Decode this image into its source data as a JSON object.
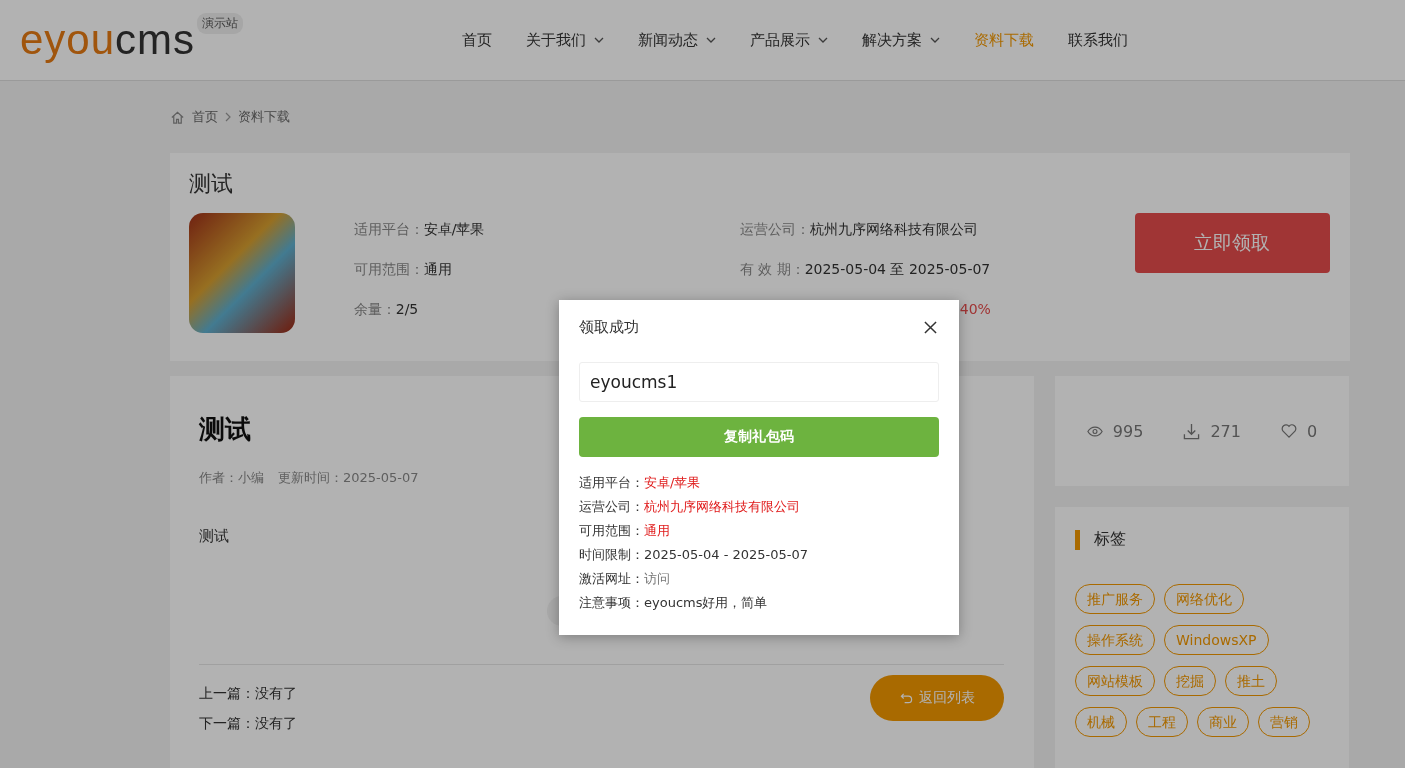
{
  "logo": {
    "brand_accent": "eyou",
    "brand_rest": "cms",
    "badge": "演示站"
  },
  "nav": [
    {
      "label": "首页",
      "dropdown": false,
      "selected": false
    },
    {
      "label": "关于我们",
      "dropdown": true,
      "selected": false
    },
    {
      "label": "新闻动态",
      "dropdown": true,
      "selected": false
    },
    {
      "label": "产品展示",
      "dropdown": true,
      "selected": false
    },
    {
      "label": "解决方案",
      "dropdown": true,
      "selected": false
    },
    {
      "label": "资料下载",
      "dropdown": false,
      "selected": true
    },
    {
      "label": "联系我们",
      "dropdown": false,
      "selected": false
    }
  ],
  "breadcrumb": [
    "首页",
    "资料下载"
  ],
  "gift": {
    "title": "测试",
    "fields": [
      {
        "label": "适用平台：",
        "value": "安卓/苹果",
        "kind": "text"
      },
      {
        "label": "运营公司：",
        "value": "杭州九序网络科技有限公司",
        "kind": "text"
      },
      {
        "label": "可用范围：",
        "value": "通用",
        "kind": "text"
      },
      {
        "label": "有 效 期：",
        "value": "2025-05-04 至 2025-05-07",
        "kind": "text"
      },
      {
        "label": "余量：",
        "value": "2/5",
        "kind": "text"
      },
      {
        "value": "40%",
        "kind": "percent"
      }
    ],
    "claim_button": "立即领取"
  },
  "article": {
    "title": "测试",
    "author": "作者：小编",
    "updated": "更新时间：2025-05-07",
    "body": "测试",
    "prev": "上一篇：没有了",
    "next": "下一篇：没有了",
    "back_button": "返回列表"
  },
  "stats": [
    {
      "kind": "views",
      "value": "995"
    },
    {
      "kind": "downloads",
      "value": "271"
    },
    {
      "kind": "likes",
      "value": "0"
    }
  ],
  "tags": {
    "title": "标签",
    "items": [
      "推广服务",
      "网络优化",
      "操作系统",
      "WindowsXP",
      "网站模板",
      "挖掘",
      "推土",
      "机械",
      "工程",
      "商业",
      "营销"
    ]
  },
  "modal": {
    "title": "领取成功",
    "code": "eyoucms1",
    "copy_button": "复制礼包码",
    "fields": [
      {
        "label": "适用平台：",
        "value": "安卓/苹果",
        "kind": "highlight"
      },
      {
        "label": "运营公司：",
        "value": "杭州九序网络科技有限公司",
        "kind": "highlight"
      },
      {
        "label": "可用范围：",
        "value": "通用",
        "kind": "highlight"
      },
      {
        "label": "时间限制：",
        "value": "2025-05-04 - 2025-05-07",
        "kind": "plain"
      },
      {
        "label": "激活网址：",
        "value": "访问",
        "kind": "link"
      },
      {
        "label": "注意事项：",
        "value": "eyoucms好用，简单",
        "kind": "plain"
      }
    ]
  }
}
